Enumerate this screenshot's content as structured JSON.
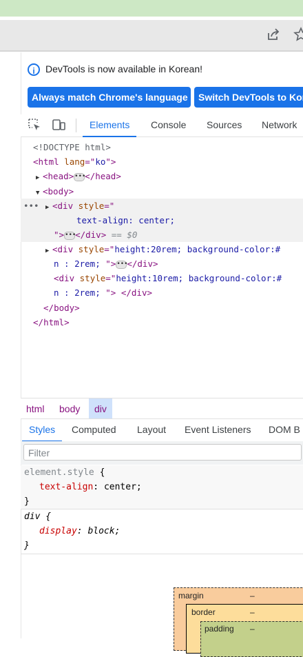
{
  "browser": {
    "share_icon": "share-icon",
    "star_icon": "star-icon"
  },
  "devtools": {
    "info_text": "DevTools is now available in Korean!",
    "btn_match": "Always match Chrome's language",
    "btn_switch": "Switch DevTools to Korean",
    "tabs": [
      "Elements",
      "Console",
      "Sources",
      "Network"
    ],
    "active_tab": "Elements"
  },
  "dom": {
    "doctype": "<!DOCTYPE html>",
    "html_open_tag": "html",
    "html_attr": "lang",
    "html_attr_val": "ko",
    "head_tag": "head",
    "body_tag": "body",
    "div_tag": "div",
    "style_attr": "style",
    "div1_style": "text-align: center;",
    "dollar": "== $0",
    "div2_style_a": "height:20rem; background-color:#",
    "div2_style_b": "n : 2rem; ",
    "div3_style_a": "height:10rem; background-color:#",
    "div3_style_b": "n : 2rem; "
  },
  "breadcrumbs": [
    "html",
    "body",
    "div"
  ],
  "styles_tabs": [
    "Styles",
    "Computed",
    "Layout",
    "Event Listeners",
    "DOM B"
  ],
  "filter_placeholder": "Filter",
  "rules": {
    "r1_selector": "element.style",
    "r1_prop": "text-align",
    "r1_val": "center",
    "r2_selector": "div",
    "r2_prop": "display",
    "r2_val": "block"
  },
  "box_model": {
    "margin_label": "margin",
    "margin_val": "–",
    "border_label": "border",
    "border_val": "–",
    "padding_label": "padding",
    "padding_val": "–"
  }
}
